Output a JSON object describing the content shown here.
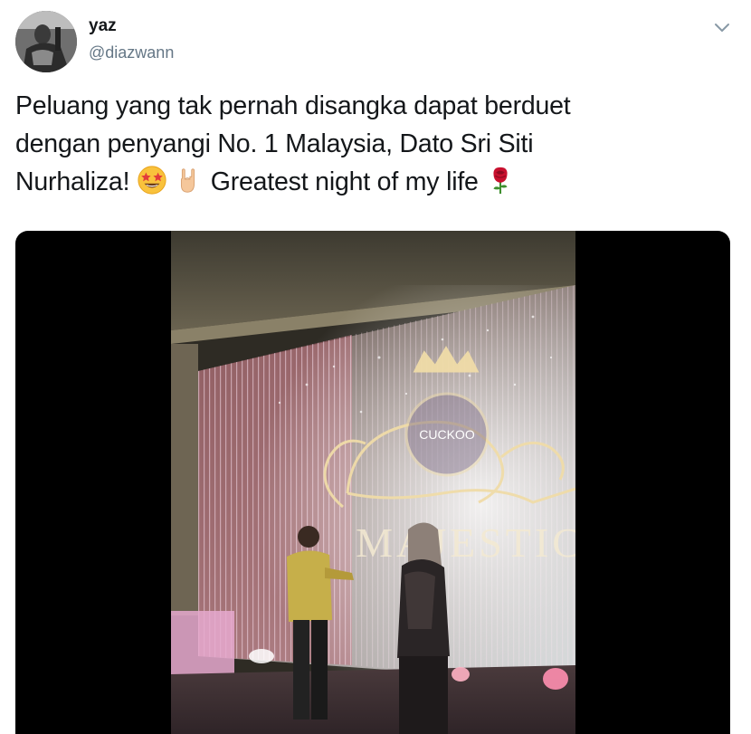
{
  "user": {
    "display_name": "yaz",
    "handle": "@diazwann",
    "avatar_icon": "profile-photo"
  },
  "menu": {
    "icon": "chevron-down-icon"
  },
  "tweet": {
    "line1": "Peluang yang tak pernah disangka dapat berduet",
    "line2": "dengan penyangi No. 1 Malaysia, Dato Sri Siti",
    "line3_a": "Nurhaliza! ",
    "line3_b": " Greatest night of my life ",
    "emojis": [
      "star-struck-emoji",
      "sign-of-horns-emoji",
      "rose-emoji"
    ]
  },
  "media": {
    "type": "video",
    "screen_text": "CUCKOO",
    "backdrop_text": "MAJESTIC"
  },
  "colors": {
    "text": "#14171a",
    "secondary": "#657786",
    "media_bg": "#000000"
  }
}
